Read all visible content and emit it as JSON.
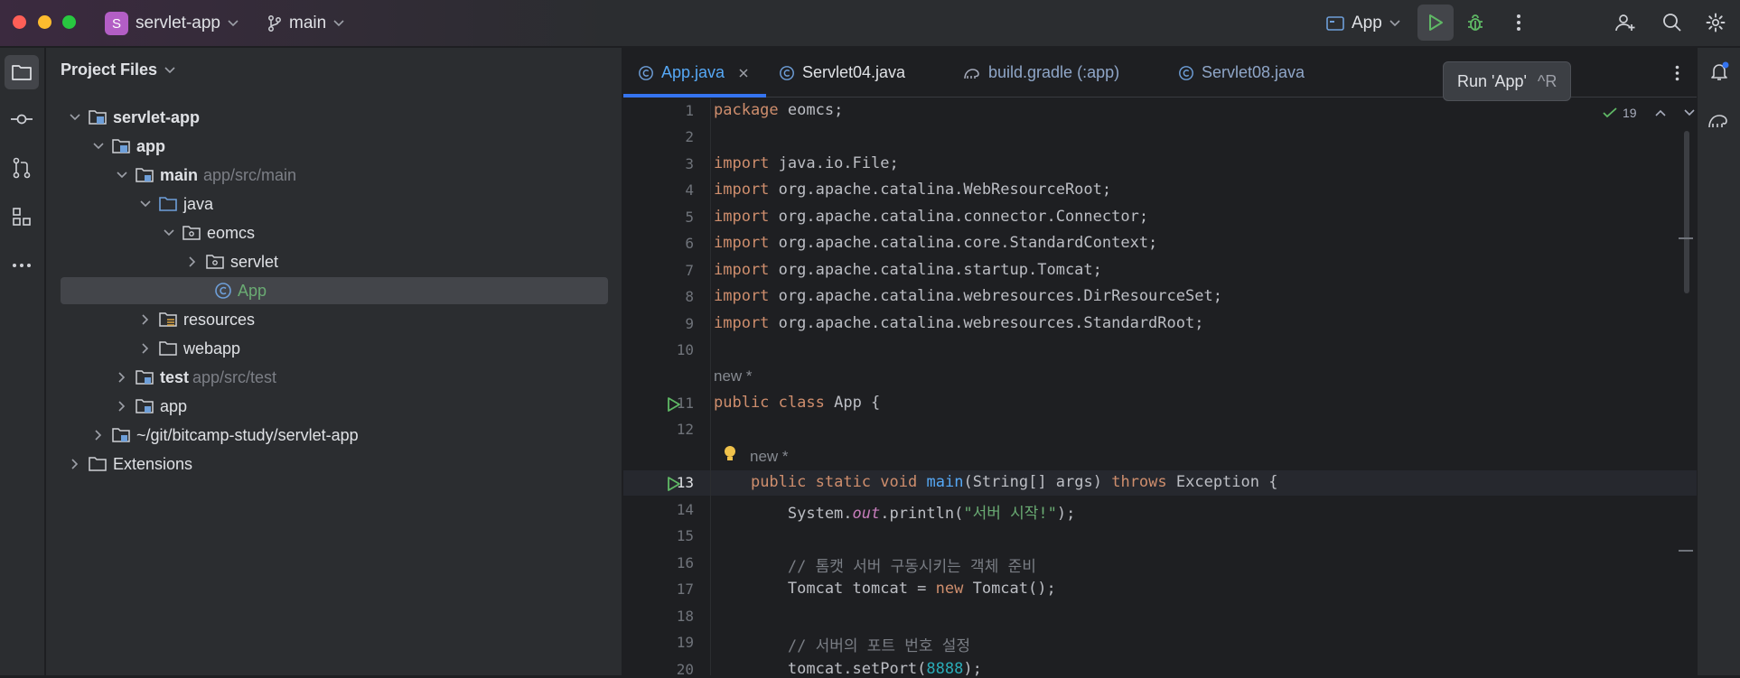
{
  "titlebar": {
    "project_badge": "S",
    "project_name": "servlet-app",
    "branch": "main",
    "run_config": "App"
  },
  "tooltip": {
    "text": "Run 'App'",
    "shortcut": "^R"
  },
  "project_panel": {
    "title": "Project Files",
    "tree": [
      {
        "label": "servlet-app",
        "bold": true
      },
      {
        "label": "app",
        "bold": true
      },
      {
        "label": "main",
        "bold": true,
        "hint": "app/src/main"
      },
      {
        "label": "java"
      },
      {
        "label": "eomcs"
      },
      {
        "label": "servlet"
      },
      {
        "label": "App"
      },
      {
        "label": "resources"
      },
      {
        "label": "webapp"
      },
      {
        "label": "test",
        "bold": true,
        "hint": "app/src/test"
      },
      {
        "label": "app"
      },
      {
        "label": "~/git/bitcamp-study/servlet-app"
      },
      {
        "label": "Extensions"
      }
    ]
  },
  "editor": {
    "tabs": [
      "App.java",
      "Servlet04.java",
      "build.gradle (:app)",
      "Servlet08.java"
    ],
    "inspection_count": "19",
    "hint_new": "new *",
    "line_numbers": [
      "1",
      "2",
      "3",
      "4",
      "5",
      "6",
      "7",
      "8",
      "9",
      "10",
      "11",
      "12",
      "13",
      "14",
      "15",
      "16",
      "17",
      "18",
      "19",
      "20"
    ],
    "lines": [
      "package eomcs;",
      "",
      "import java.io.File;",
      "import org.apache.catalina.WebResourceRoot;",
      "import org.apache.catalina.connector.Connector;",
      "import org.apache.catalina.core.StandardContext;",
      "import org.apache.catalina.startup.Tomcat;",
      "import org.apache.catalina.webresources.DirResourceSet;",
      "import org.apache.catalina.webresources.StandardRoot;",
      "",
      "public class App {",
      "",
      "    public static void main(String[] args) throws Exception {",
      "        System.out.println(\"서버 시작!\");",
      "",
      "        // 톰캣 서버 구동시키는 객체 준비",
      "        Tomcat tomcat = new Tomcat();",
      "",
      "        // 서버의 포트 번호 설정",
      "        tomcat.setPort(8888);"
    ]
  },
  "colors": {
    "accent": "#3574f0",
    "run_green": "#5fb865",
    "folder_blue": "#6e9fd9"
  },
  "icons": [
    "folder-icon",
    "commit-icon",
    "pull-request-icon",
    "structure-icon",
    "more-icon",
    "notifications-icon",
    "gradle-icon",
    "add-user-icon",
    "search-icon",
    "gear-icon",
    "run-icon",
    "debug-icon",
    "lightbulb-icon"
  ]
}
